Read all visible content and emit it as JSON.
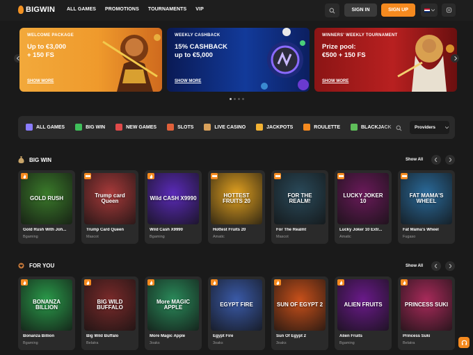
{
  "header": {
    "logo_text": "BIGWIN",
    "nav": [
      "ALL GAMES",
      "PROMOTIONS",
      "TOURNAMENTS",
      "VIP"
    ],
    "signin_label": "SIGN IN",
    "signup_label": "SIGN UP",
    "icons": [
      "search-icon",
      "flag-icon",
      "chevron-down-icon",
      "support-icon"
    ]
  },
  "banners": [
    {
      "tag": "WELCOME PACKAGE",
      "line1": "Up to €3,000",
      "line2": "+ 150 FS",
      "more": "SHOW MORE",
      "color": "#ef9a2c"
    },
    {
      "tag": "WEEKLY CASHBACK",
      "line1": "15% CASHBACK",
      "line2": "up to €5,000",
      "more": "SHOW MORE",
      "color": "#123a9a"
    },
    {
      "tag": "WINNERS' WEEKLY TOURNAMENT",
      "line1": "Prize pool:",
      "line2": "€500 + 150 FS",
      "more": "SHOW MORE",
      "color": "#b82020"
    }
  ],
  "categories": [
    {
      "label": "ALL GAMES",
      "icon": "dice-icon",
      "color": "#8a7cff"
    },
    {
      "label": "BIG WIN",
      "icon": "money-bag-icon",
      "color": "#3fbf5a"
    },
    {
      "label": "NEW GAMES",
      "icon": "new-badge-icon",
      "color": "#e04a4a"
    },
    {
      "label": "SLOTS",
      "icon": "slot-machine-icon",
      "color": "#e0603a"
    },
    {
      "label": "LIVE CASINO",
      "icon": "dealer-icon",
      "color": "#d9a15b"
    },
    {
      "label": "JACKPOTS",
      "icon": "crown-icon",
      "color": "#f2b233"
    },
    {
      "label": "ROULETTE",
      "icon": "roulette-icon",
      "color": "#f58a1f"
    },
    {
      "label": "BLACKJACK",
      "icon": "chips-icon",
      "color": "#5fbf5a"
    }
  ],
  "providers_label": "Providers",
  "sections": [
    {
      "title": "BIG WIN",
      "show_all": "Show All",
      "games": [
        {
          "name": "Gold Rush With Joh...",
          "provider": "Bgaming",
          "thumb_text": "GOLD RUSH",
          "bg": "#3a7a2a",
          "badge": "hot"
        },
        {
          "name": "Trump Card Queen",
          "provider": "Mascot",
          "thumb_text": "Trump card Queen",
          "bg": "#a83a3a",
          "badge": "new"
        },
        {
          "name": "Wild Cash X9990",
          "provider": "Bgaming",
          "thumb_text": "Wild CASH X9990",
          "bg": "#5a2ab8",
          "badge": "hot"
        },
        {
          "name": "Hottest Fruits 20",
          "provider": "Amatic",
          "thumb_text": "HOTTEST FRUITS 20",
          "bg": "#e0a020",
          "badge": "new"
        },
        {
          "name": "For The Realm!",
          "provider": "Mascot",
          "thumb_text": "FOR THE REALM!",
          "bg": "#2a4a5a",
          "badge": "new"
        },
        {
          "name": "Lucky Joker 10 Extr...",
          "provider": "Amatic",
          "thumb_text": "LUCKY JOKER 10",
          "bg": "#6a1a5a",
          "badge": "new"
        },
        {
          "name": "Fat Mama's Wheel",
          "provider": "Fugaso",
          "thumb_text": "FAT MAMA'S WHEEL",
          "bg": "#2a6a9a",
          "badge": "new"
        }
      ]
    },
    {
      "title": "FOR YOU",
      "show_all": "Show All",
      "games": [
        {
          "name": "Bonanza Billion",
          "provider": "Bgaming",
          "thumb_text": "BONANZA BILLION",
          "bg": "#2a9a4a",
          "badge": "hot"
        },
        {
          "name": "Big Wild Buffalo",
          "provider": "Belatra",
          "thumb_text": "BIG WILD BUFFALO",
          "bg": "#7a2a2a",
          "badge": "hot"
        },
        {
          "name": "More Magic Apple",
          "provider": "3oaks",
          "thumb_text": "More MAGIC APPLE",
          "bg": "#2a8a5a",
          "badge": "hot"
        },
        {
          "name": "Egypt Fire",
          "provider": "3oaks",
          "thumb_text": "EGYPT FIRE",
          "bg": "#3a5aa8",
          "badge": "hot"
        },
        {
          "name": "Sun Of Egypt 2",
          "provider": "3oaks",
          "thumb_text": "SUN OF EGYPT 2",
          "bg": "#c8501a",
          "badge": "hot"
        },
        {
          "name": "Alien Fruits",
          "provider": "Bgaming",
          "thumb_text": "ALIEN FRUITS",
          "bg": "#6a1a8a",
          "badge": "hot"
        },
        {
          "name": "Princess Suki",
          "provider": "Belatra",
          "thumb_text": "PRINCESS SUKI",
          "bg": "#a82a5a",
          "badge": "hot"
        }
      ]
    }
  ]
}
